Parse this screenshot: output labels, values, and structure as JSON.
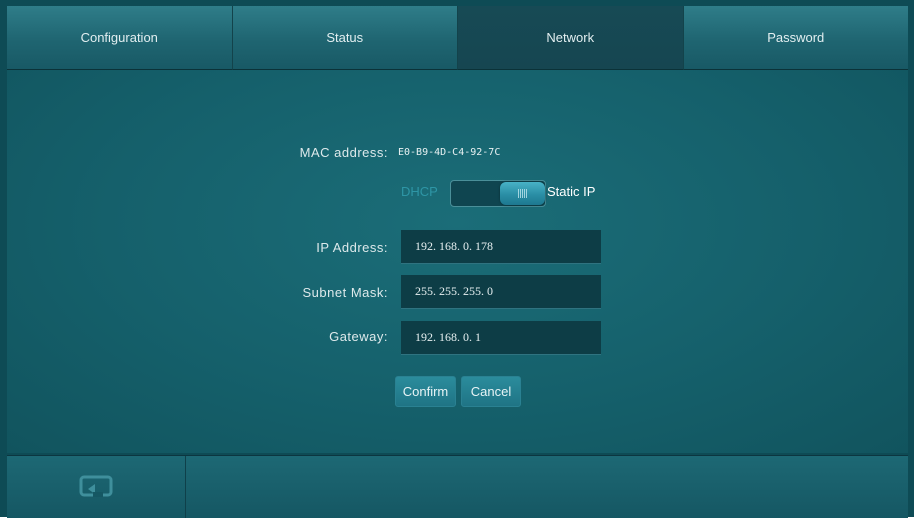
{
  "tabs": [
    {
      "label": "Configuration",
      "active": false
    },
    {
      "label": "Status",
      "active": false
    },
    {
      "label": "Network",
      "active": true
    },
    {
      "label": "Password",
      "active": false
    }
  ],
  "network": {
    "mac_label": "MAC address:",
    "mac_value": "E0-B9-4D-C4-92-7C",
    "mode_toggle": {
      "left_label": "DHCP",
      "right_label": "Static IP",
      "selected": "Static IP"
    },
    "ip_label": "IP Address:",
    "ip_value": "192. 168. 0. 178",
    "subnet_label": "Subnet Mask:",
    "subnet_value": "255. 255. 255. 0",
    "gateway_label": "Gateway:",
    "gateway_value": "192. 168. 0. 1",
    "confirm_label": "Confirm",
    "cancel_label": "Cancel"
  },
  "bottom_bar": {
    "back_icon": "return-icon"
  },
  "colors": {
    "background": "#0e4b55",
    "panel": "#15606b",
    "tab": "#1f6571",
    "tab_active": "#164651",
    "field": "#0d3d46",
    "accent": "#2a8ea5",
    "dhcp_text": "#2e96a6"
  }
}
